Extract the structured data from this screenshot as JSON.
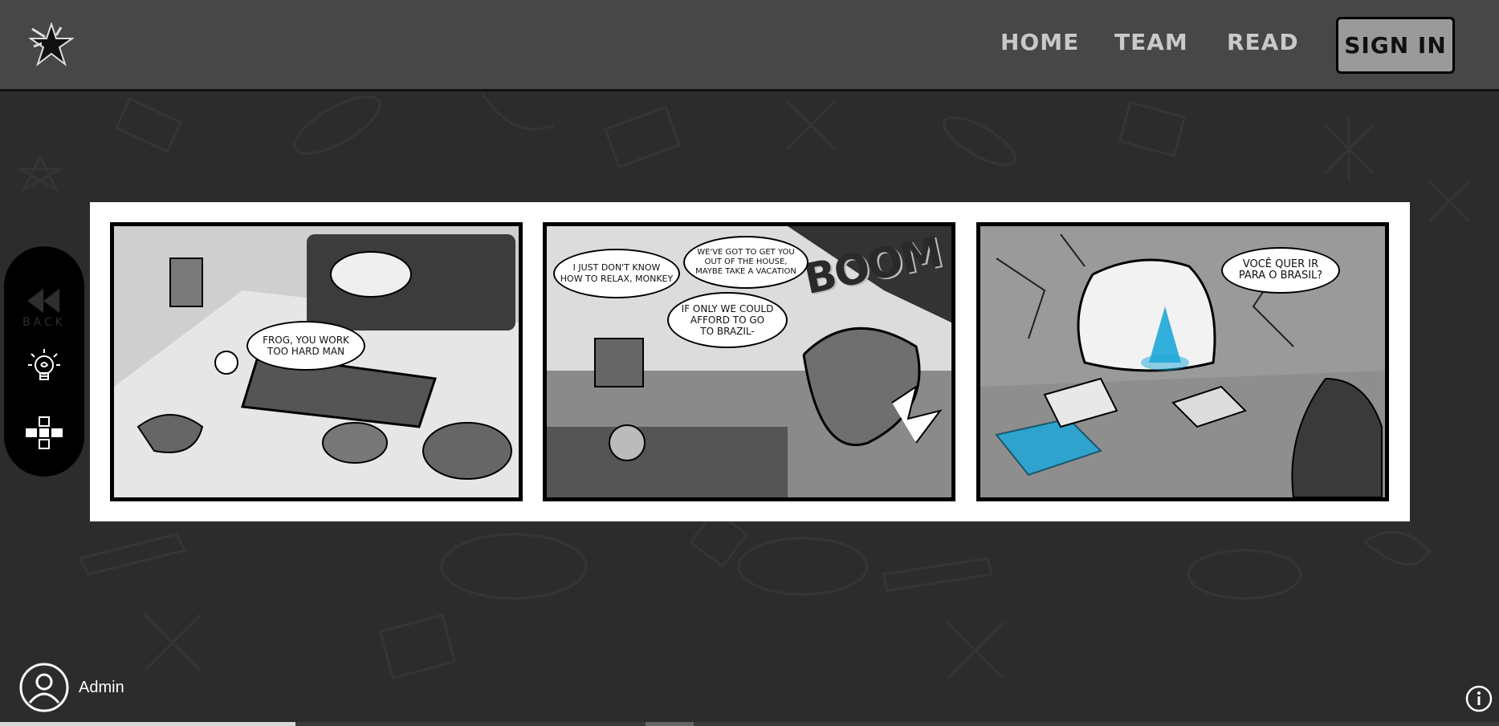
{
  "nav": {
    "home": "HOME",
    "team": "TEAM",
    "read": "READ",
    "signin": "SIGN IN"
  },
  "logo": {
    "icon": "star-splash-logo-icon"
  },
  "sidebar": {
    "back_label": "BACK",
    "back_icon": "double-arrow-back-icon",
    "hint_icon": "lightbulb-icon",
    "grid_icon": "panel-grid-icon"
  },
  "comic": {
    "panel1": {
      "bubble1": "FROG, YOU WORK\nTOO HARD MAN"
    },
    "panel2": {
      "bubble1": "I JUST DON'T KNOW\nHOW TO RELAX, MONKEY",
      "bubble2": "WE'VE GOT TO GET YOU\nOUT OF THE HOUSE,\nMAYBE TAKE A VACATION",
      "bubble3": "IF ONLY WE COULD\nAFFORD TO GO\nTO BRAZIL-",
      "sfx": "BOOM"
    },
    "panel3": {
      "bubble1": "VOCÊ QUER IR\nPARA O BRASIL?"
    }
  },
  "user": {
    "name": "Admin",
    "icon": "user-avatar-icon"
  },
  "info_icon": "info-icon",
  "colors": {
    "header": "#474747",
    "background": "#2c2c2c",
    "glow": "#1ea7d8"
  }
}
